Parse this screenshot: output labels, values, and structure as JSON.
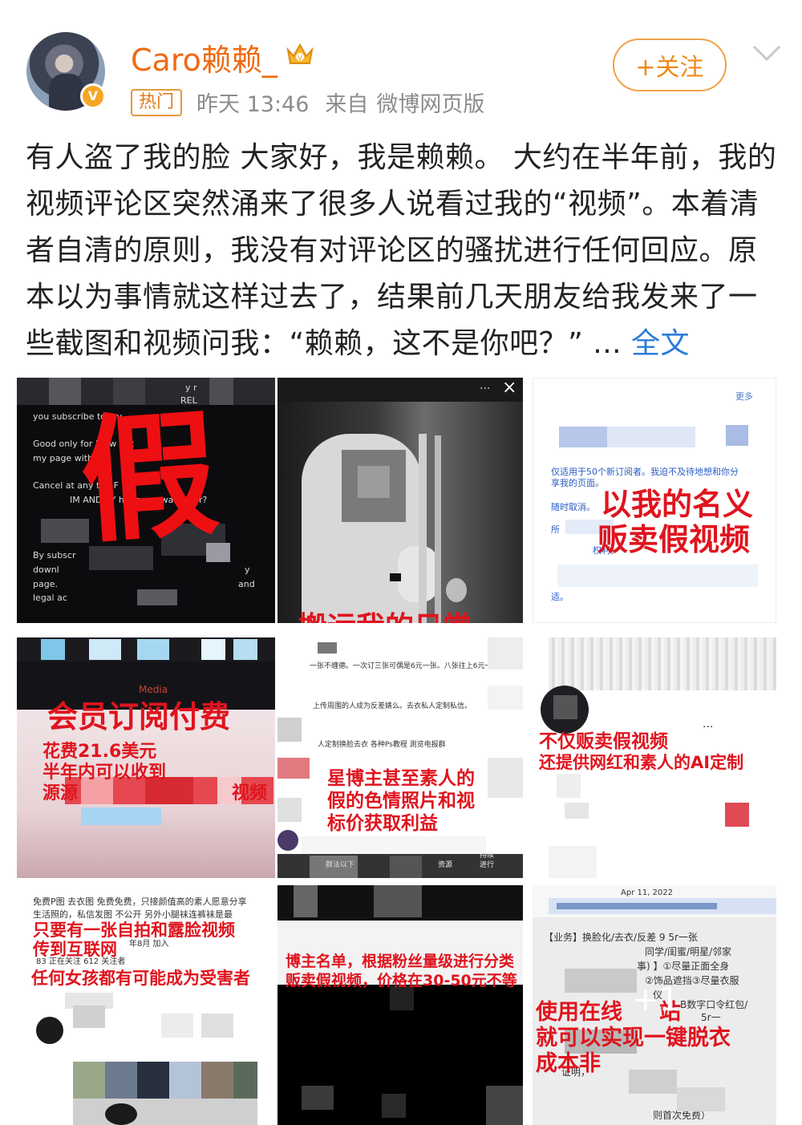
{
  "header": {
    "username": "Caro赖赖_",
    "hot_tag": "热门",
    "time": "昨天 13:46",
    "source_prefix": "来自",
    "source": "微博网页版",
    "follow_label": "+关注",
    "verified_badge": "V"
  },
  "post": {
    "text": "有人盗了我的脸  大家好，我是赖赖。 大约在半年前，我的视频评论区突然涌来了很多人说看过我的“视频”。本着清者自清的原则，我没有对评论区的骚扰进行任何回应。原本以为事情就这样过去了，结果前几天朋友给我发来了一些截图和视频问我：“赖赖，这不是你吧？” ... ",
    "more_label": "全文"
  },
  "images": {
    "img1": {
      "overlay": "假",
      "lines": [
        "you subscribe today",
        "Good only for 5  ew  bsc",
        "my page with",
        "Cancel at any t  e. F",
        "IM AND  AY  hat are y  wa  ng for?",
        "By subscr",
        "downl",
        "page.",
        "legal ac",
        "y",
        "and",
        "y r",
        "REL"
      ]
    },
    "img2": {
      "overlay": "搬运我的日常",
      "menu": "···",
      "close": "×"
    },
    "img3": {
      "overlay_line1": "以我的名义",
      "overlay_line2": "贩卖假视频",
      "more": "更多",
      "lines": [
        "仅适用于50个新订阅者。我迫不及待地想和你分",
        "享我的页面。",
        "随时取消。",
        "所",
        "权利。",
        "适。"
      ]
    },
    "img4": {
      "overlay_title": "会员订阅付费",
      "overlay_l1": "花费21.6美元",
      "overlay_l2": "半年内可以收到",
      "overlay_l3": "源源",
      "overlay_l3b": "视频",
      "media": "Media"
    },
    "img5": {
      "lines": [
        "一张不缠德。一次订三张可偶是6元一张。八张往上6元一",
        "上传周围的人成为反差婊么。去衣私人定制私信。",
        "人定制换脸去衣 各种Ps教程 測览电报群",
        "持续",
        "群法以下",
        "进行",
        "资源"
      ],
      "overlay_l1": "星博主甚至素人的",
      "overlay_l2": "假的色情照片和视",
      "overlay_l3": "标价获取利益"
    },
    "img6": {
      "overlay_l1": "不仅贩卖假视频",
      "overlay_l2": "还提供网红和素人的AI定制",
      "dots": "···"
    },
    "img7": {
      "line1": "免费P图 去衣图 免费免费，只接颜值高的素人愿意分享",
      "line2": "生活照的，私信发图 不公开 另外小腿袜连裤袜是最",
      "overlay_l1": "只要有一张自拍和露脸视频",
      "overlay_l2": "传到互联网",
      "stat1": "83 正在关注  612 关注者",
      "joined": "年8月 加入",
      "overlay_l3": "任何女孩都有可能成为受害者"
    },
    "img8": {
      "overlay_l1": "博主名单，根据粉丝量级进行分类",
      "overlay_l2": "贩卖假视频，价格在30-50元不等"
    },
    "img9": {
      "date": "Apr 11, 2022",
      "biz_line": "【业务】换脸化/去衣/反差 9  5r一张",
      "l2": "同学/闺蜜/明星/邻家",
      "l3": "事) 】①尽量正面全身",
      "l4": "②饰品遮挡③尽量衣服",
      "l5": "仪",
      "l6": "B数字口令红包/",
      "l7": "5r一",
      "l8": "证明，",
      "l9": "则首次免费）",
      "overlay_l1": "使用在线",
      "overlay_l1b": "站",
      "overlay_l2": "就可以实现一键脱衣",
      "overlay_l3": "成本非",
      "plus_one": "+1"
    }
  }
}
